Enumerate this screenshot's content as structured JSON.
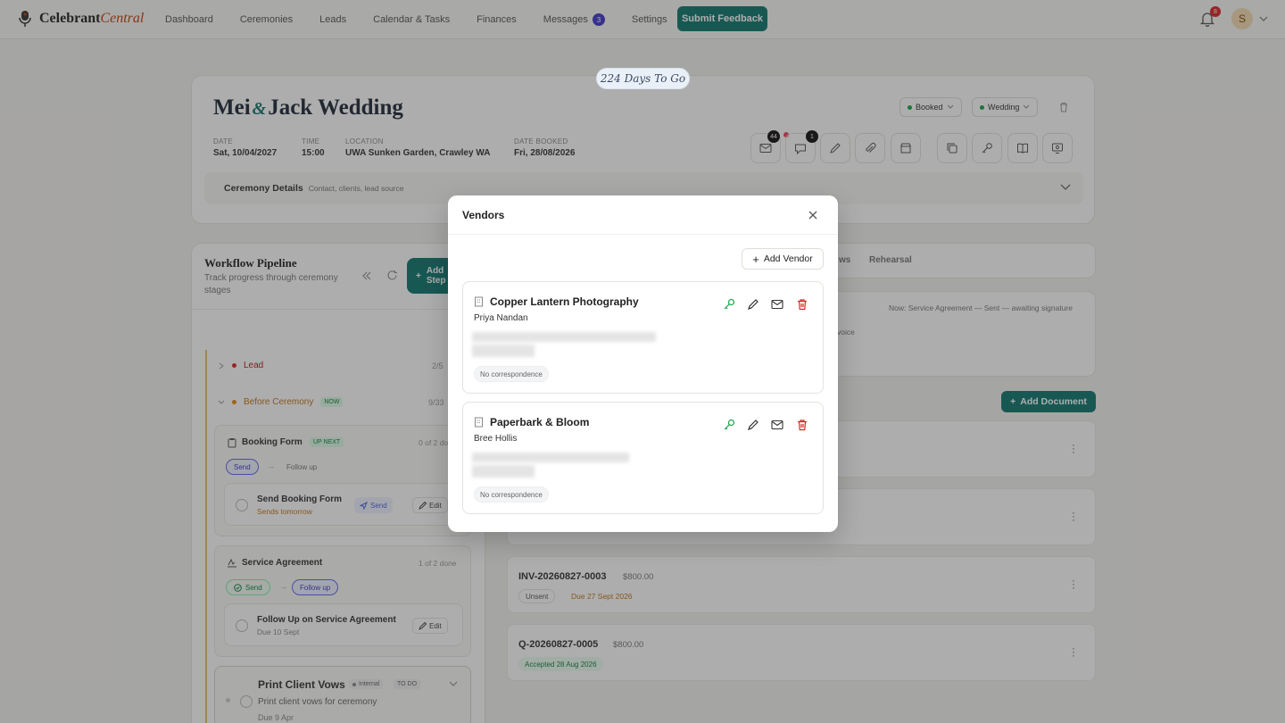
{
  "nav": {
    "brand_a": "Celebrant",
    "brand_b": "Central",
    "links": [
      "Dashboard",
      "Ceremonies",
      "Leads",
      "Calendar & Tasks",
      "Finances",
      "Messages",
      "Settings"
    ],
    "messages_badge": "3",
    "feedback": "Submit Feedback",
    "bell_badge": "8",
    "avatar": "S"
  },
  "header": {
    "countdown": "224 Days To Go",
    "name_a": "Mei",
    "amp": "&",
    "name_b": "Jack Wedding",
    "status": "Booked",
    "type": "Wedding",
    "meta": [
      {
        "label": "DATE",
        "value": "Sat, 10/04/2027"
      },
      {
        "label": "TIME",
        "value": "15:00"
      },
      {
        "label": "LOCATION",
        "value": "UWA Sunken Garden, Crawley WA"
      },
      {
        "label": "DATE BOOKED",
        "value": "Fri, 28/08/2026"
      }
    ],
    "mail_badge": "44",
    "chat_badge": "1",
    "details_title": "Ceremony Details",
    "details_sub": "Contact, clients, lead source"
  },
  "pipeline": {
    "title": "Workflow Pipeline",
    "subtitle": "Track progress through ceremony stages",
    "add_btn": "Add Step",
    "lead": {
      "label": "Lead",
      "count": "2/5"
    },
    "before": {
      "label": "Before Ceremony",
      "tag": "NOW",
      "count": "9/33"
    },
    "booking": {
      "title": "Booking Form",
      "tag": "UP NEXT",
      "count": "0 of 2 done",
      "chip_send": "Send",
      "chip_follow": "Follow up",
      "task": "Send Booking Form",
      "task_sub": "Sends tomorrow",
      "send_btn": "Send",
      "edit_btn": "Edit"
    },
    "service": {
      "title": "Service Agreement",
      "count": "1 of 2 done",
      "chip_send": "Send",
      "chip_follow": "Follow up",
      "task": "Follow Up on Service Agreement",
      "task_sub": "Due 10 Sept",
      "edit_btn": "Edit"
    },
    "print": {
      "title": "Print Client Vows",
      "tag1": "Internal",
      "tag2": "TO DO",
      "sub": "Print client vows for ceremony",
      "due": "Due 9 Apr"
    }
  },
  "right": {
    "tab_vows": "ws",
    "tab_rehearsal": "Rehearsal",
    "now_status": "Now: Service Agreement — Sent — awaiting signature",
    "voice": "voice",
    "add_document": "Add Document",
    "docs": [
      {
        "id": "INV-20260827-0003",
        "amount": "$800.00",
        "badge": "Unsent",
        "note": "Due 27 Sept 2026"
      },
      {
        "id": "Q-20260827-0005",
        "amount": "$800.00",
        "badge": "",
        "note": "Accepted 28 Aug 2026"
      }
    ]
  },
  "modal": {
    "title": "Vendors",
    "add_vendor": "Add Vendor",
    "vendors": [
      {
        "name": "Copper Lantern Photography",
        "contact": "Priya Nandan",
        "status": "No correspondence"
      },
      {
        "name": "Paperbark & Bloom",
        "contact": "Bree Hollis",
        "status": "No correspondence"
      }
    ]
  },
  "colors": {
    "brand": "#0f766e",
    "accent": "#c2410c",
    "danger": "#dc2626",
    "badge": "#4338ca"
  }
}
